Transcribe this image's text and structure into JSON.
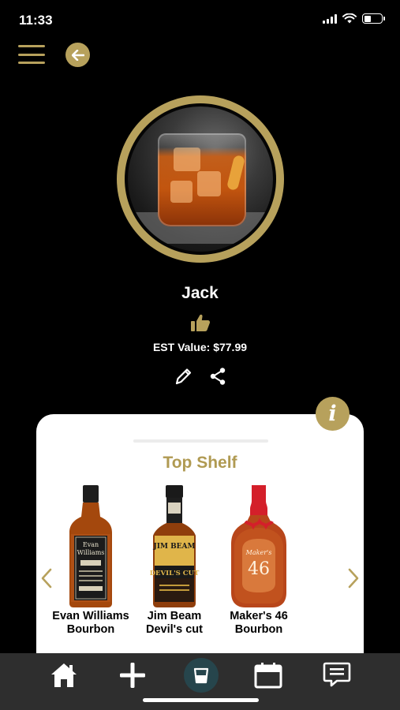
{
  "status_bar": {
    "time": "11:33",
    "battery_level": 0.4
  },
  "header": {
    "menu_icon": "hamburger-menu-icon",
    "back_icon": "back-arrow-icon"
  },
  "profile": {
    "name": "Jack",
    "est_value": "EST Value: $77.99",
    "actions": [
      "thumbs-up-icon",
      "edit-pencil-icon",
      "share-icon"
    ]
  },
  "shelf": {
    "title": "Top Shelf",
    "info_label": "i",
    "bottles": [
      {
        "name": "Evan Williams Bourbon",
        "label_lines": [
          "Evan",
          "Williams"
        ]
      },
      {
        "name": "Jim Beam Devil's cut",
        "label_lines": [
          "JIM BEAM",
          "DEVIL'S CUT"
        ]
      },
      {
        "name": "Maker's 46 Bourbon",
        "label_lines": [
          "Maker's",
          "46"
        ]
      }
    ]
  },
  "tab_bar": {
    "tabs": [
      "home-icon",
      "add-icon",
      "bar-glass-icon",
      "calendar-icon",
      "messages-icon"
    ]
  },
  "colors": {
    "accent_gold": "#b7a15c",
    "title_gold": "#b09a52",
    "background": "#000000",
    "tab_bar": "#2e2e2e",
    "active_tab": "#26454c"
  }
}
